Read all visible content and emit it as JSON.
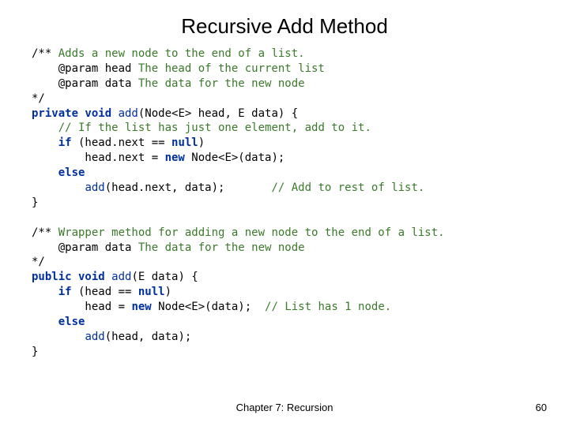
{
  "title": "Recursive Add Method",
  "code": {
    "c1a": "/** ",
    "c1b": "Adds a new node to the end of a list.",
    "c1c": "    @param head ",
    "c1d": "The head of the current list",
    "c1e": "    @param data ",
    "c1f": "The data for the new node",
    "c1g": "*/",
    "l1a": "private void ",
    "l1b": "add",
    "l1c": "(Node<E> head, E data) {",
    "l2a": "    ",
    "l2b": "// If the list has just one element, add to it.",
    "l3a": "    ",
    "l3b": "if",
    "l3c": " (head.next == ",
    "l3d": "null",
    "l3e": ")",
    "l4a": "        head.next = ",
    "l4b": "new",
    "l4c": " Node<E>(data);",
    "l5a": "    ",
    "l5b": "else",
    "l6a": "        ",
    "l6b": "add",
    "l6c": "(head.next, data);       ",
    "l6d": "// Add to rest of list.",
    "l7a": "}",
    "c2a": "/** ",
    "c2b": "Wrapper method for adding a new node to the end of a list.",
    "c2c": "    @param data ",
    "c2d": "The data for the new node",
    "c2e": "*/",
    "l8a": "public void ",
    "l8b": "add",
    "l8c": "(E data) {",
    "l9a": "    ",
    "l9b": "if",
    "l9c": " (head == ",
    "l9d": "null",
    "l9e": ")",
    "l10a": "        head = ",
    "l10b": "new",
    "l10c": " Node<E>(data);  ",
    "l10d": "// List has 1 node.",
    "l11a": "    ",
    "l11b": "else",
    "l12a": "        ",
    "l12b": "add",
    "l12c": "(head, data);",
    "l13a": "}"
  },
  "footer": {
    "center": "Chapter 7: Recursion",
    "page": "60"
  }
}
